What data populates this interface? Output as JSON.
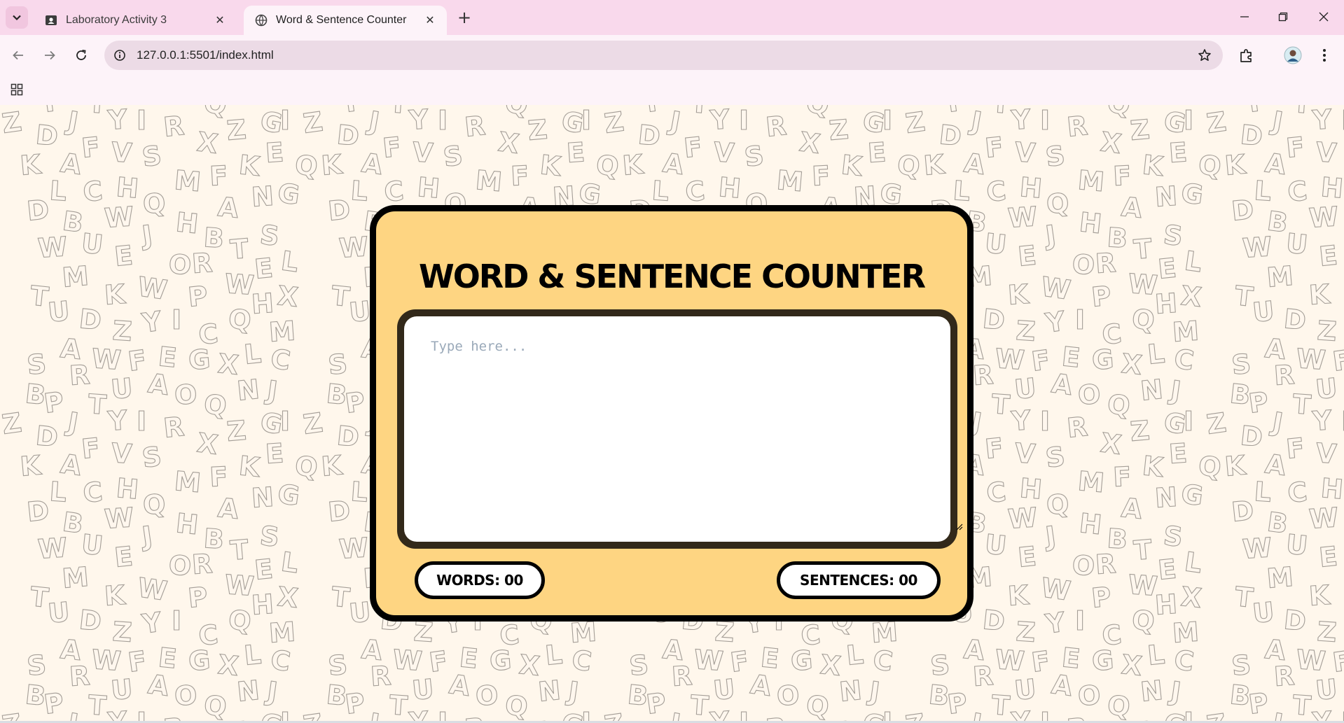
{
  "browser": {
    "tabs": [
      {
        "title": "Laboratory Activity 3",
        "active": false,
        "favicon": "classroom-favicon-icon"
      },
      {
        "title": "Word & Sentence Counter",
        "active": true,
        "favicon": "globe-favicon-icon"
      }
    ],
    "url": "127.0.0.1:5501/index.html",
    "icons": {
      "tab_search": "chevron-down-icon",
      "new_tab": "+",
      "close": "✕"
    }
  },
  "page": {
    "title": "WORD & SENTENCE COUNTER",
    "textarea_placeholder": "Type here...",
    "textarea_value": "",
    "words_label": "WORDS: 00",
    "sentences_label": "SENTENCES: 00"
  },
  "colors": {
    "card_background": "#fed582",
    "card_border": "#000000",
    "page_background": "#fff7ec",
    "tabstrip": "#f9d9ec"
  }
}
